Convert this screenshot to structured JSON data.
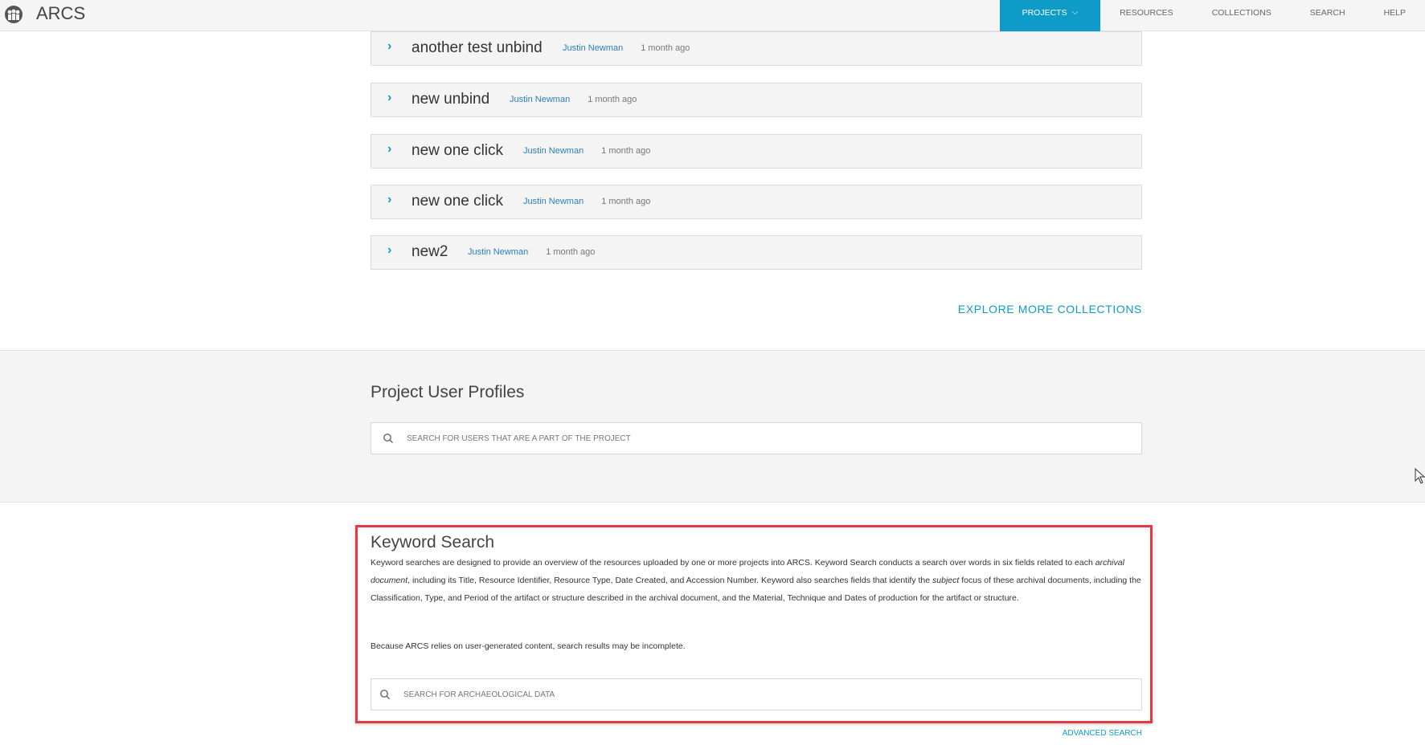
{
  "app": {
    "brand": "ARCS",
    "logo_icon": "arcs-logo-icon"
  },
  "nav": {
    "items": [
      {
        "label": "PROJECTS",
        "active": true
      },
      {
        "label": "RESOURCES"
      },
      {
        "label": "COLLECTIONS"
      },
      {
        "label": "SEARCH"
      },
      {
        "label": "HELP"
      }
    ]
  },
  "collections": [
    {
      "title": "another test unbind",
      "author": "Justin Newman",
      "time": "1 month ago"
    },
    {
      "title": "new unbind",
      "author": "Justin Newman",
      "time": "1 month ago"
    },
    {
      "title": "new one click",
      "author": "Justin Newman",
      "time": "1 month ago"
    },
    {
      "title": "new one click",
      "author": "Justin Newman",
      "time": "1 month ago"
    },
    {
      "title": "new2",
      "author": "Justin Newman",
      "time": "1 month ago"
    }
  ],
  "explore_label": "EXPLORE MORE COLLECTIONS",
  "profiles": {
    "heading": "Project User Profiles",
    "search_placeholder": "SEARCH FOR USERS THAT ARE A PART OF THE PROJECT"
  },
  "keyword": {
    "heading": "Keyword Search",
    "desc_1": "Keyword searches are designed to provide an overview of the resources uploaded by one or more projects into ARCS. Keyword Search conducts a search over words in six fields related to each ",
    "desc_em1": "archival document",
    "desc_2": ", including its Title, Resource Identifier, Resource Type, Date Created, and Accession Number. Keyword also searches fields that identify the ",
    "desc_em2": "subject",
    "desc_3": " focus of these archival documents, including the Classification, Type, and Period of the artifact or structure described in the archival document, and the Material, Technique and Dates of production for the artifact or structure.",
    "note": "Because ARCS relies on user-generated content, search results may be incomplete.",
    "search_placeholder": "SEARCH FOR ARCHAEOLOGICAL DATA",
    "advanced_label": "ADVANCED SEARCH"
  },
  "colors": {
    "accent": "#0e9bc7",
    "highlight": "#e23a40",
    "author_link": "#2a7fb8"
  }
}
